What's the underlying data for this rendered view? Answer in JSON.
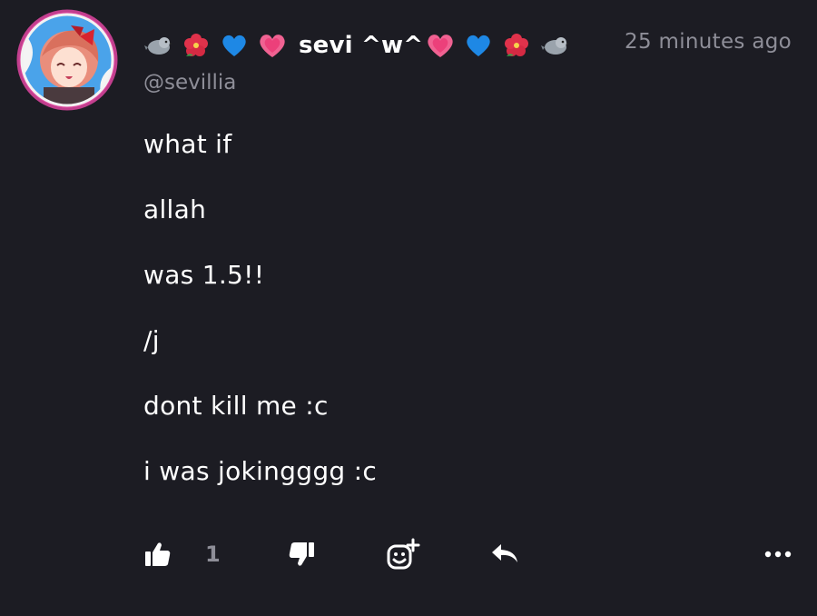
{
  "post": {
    "author": {
      "display_name": "sevi ^w^",
      "handle": "@sevillia",
      "avatar": "anime-avatar-icon"
    },
    "name_emojis_left": [
      "pigeon-icon",
      "hibiscus-icon",
      "blue-heart-icon",
      "growing-heart-icon"
    ],
    "name_emojis_right": [
      "growing-heart-icon",
      "blue-heart-icon",
      "hibiscus-icon",
      "pigeon-icon"
    ],
    "timestamp": "25 minutes ago",
    "body_lines": [
      "what if",
      "allah",
      "was 1.5!!",
      "/j",
      "dont kill me :c",
      "i was jokingggg :c"
    ],
    "actions": {
      "like_icon": "thumbs-up-icon",
      "like_count": "1",
      "dislike_icon": "thumbs-down-icon",
      "react_icon": "add-reaction-icon",
      "reply_icon": "reply-icon",
      "more_icon": "more-options-icon"
    },
    "colors": {
      "background": "#1c1c23",
      "text": "#ffffff",
      "muted": "#8e8e98"
    }
  }
}
